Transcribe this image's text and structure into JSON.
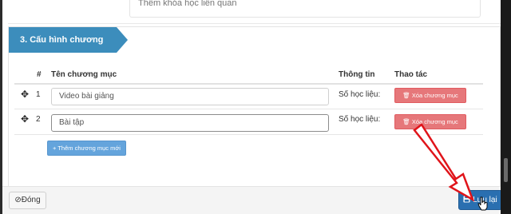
{
  "previous_field": {
    "placeholder": "Thêm khóa học liên quan"
  },
  "section": {
    "title": "3. Cấu hình chương mục"
  },
  "table": {
    "headers": {
      "index": "#",
      "name": "Tên chương mục",
      "info": "Thông tin",
      "actions": "Thao tác"
    },
    "rows": [
      {
        "index": "1",
        "name": "Video bài giảng",
        "info": "Số học liệu:",
        "delete_label": "Xóa chương mục"
      },
      {
        "index": "2",
        "name": "Bài tập",
        "info": "Số học liệu:",
        "delete_label": "Xóa chương mục"
      }
    ]
  },
  "add_button": {
    "label": "+ Thêm chương mục mới"
  },
  "footer": {
    "close_label": "Đóng",
    "save_label": "Lưu lại"
  },
  "icons": {
    "move": "move-arrows-icon",
    "trash": "trash-icon",
    "close": "ban-icon",
    "save": "floppy-disk-icon"
  },
  "colors": {
    "accent": "#3c8dbc",
    "danger": "#e6777a",
    "add_button": "#64a4dc",
    "save_button": "#2a6fb0",
    "annotation_arrow": "#e0141a"
  }
}
